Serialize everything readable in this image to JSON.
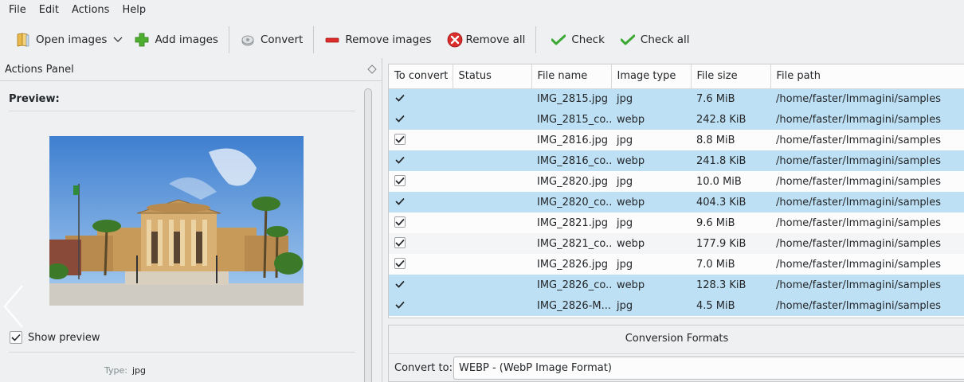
{
  "menubar": {
    "items": [
      "File",
      "Edit",
      "Actions",
      "Help"
    ]
  },
  "toolbar": {
    "open_images": "Open images",
    "add_images": "Add images",
    "convert": "Convert",
    "remove_images": "Remove images",
    "remove_all": "Remove all",
    "check": "Check",
    "check_all": "Check all"
  },
  "actions_panel": {
    "title": "Actions Panel",
    "preview_label": "Preview:",
    "show_preview_label": "Show preview",
    "show_preview_checked": true,
    "type_label": "Type:",
    "type_value": "jpg"
  },
  "table": {
    "columns": [
      "To convert",
      "Status",
      "File name",
      "Image type",
      "File size",
      "File path"
    ],
    "rows": [
      {
        "checked": true,
        "status": "",
        "name": "IMG_2815.jpg",
        "type": "jpg",
        "size": "7.6 MiB",
        "path": "/home/faster/Immagini/samples",
        "selected": true
      },
      {
        "checked": true,
        "status": "",
        "name": "IMG_2815_co...",
        "type": "webp",
        "size": "242.8 KiB",
        "path": "/home/faster/Immagini/samples",
        "selected": true
      },
      {
        "checked": true,
        "status": "",
        "name": "IMG_2816.jpg",
        "type": "jpg",
        "size": "8.8 MiB",
        "path": "/home/faster/Immagini/samples",
        "selected": false
      },
      {
        "checked": true,
        "status": "",
        "name": "IMG_2816_co...",
        "type": "webp",
        "size": "241.8 KiB",
        "path": "/home/faster/Immagini/samples",
        "selected": true
      },
      {
        "checked": true,
        "status": "",
        "name": "IMG_2820.jpg",
        "type": "jpg",
        "size": "10.0 MiB",
        "path": "/home/faster/Immagini/samples",
        "selected": false
      },
      {
        "checked": true,
        "status": "",
        "name": "IMG_2820_co...",
        "type": "webp",
        "size": "404.3 KiB",
        "path": "/home/faster/Immagini/samples",
        "selected": true
      },
      {
        "checked": true,
        "status": "",
        "name": "IMG_2821.jpg",
        "type": "jpg",
        "size": "9.6 MiB",
        "path": "/home/faster/Immagini/samples",
        "selected": false
      },
      {
        "checked": true,
        "status": "",
        "name": "IMG_2821_co...",
        "type": "webp",
        "size": "177.9 KiB",
        "path": "/home/faster/Immagini/samples",
        "selected": false
      },
      {
        "checked": true,
        "status": "",
        "name": "IMG_2826.jpg",
        "type": "jpg",
        "size": "7.0 MiB",
        "path": "/home/faster/Immagini/samples",
        "selected": false
      },
      {
        "checked": true,
        "status": "",
        "name": "IMG_2826_co...",
        "type": "webp",
        "size": "128.3 KiB",
        "path": "/home/faster/Immagini/samples",
        "selected": true
      },
      {
        "checked": true,
        "status": "",
        "name": "IMG_2826-M...",
        "type": "jpg",
        "size": "4.5 MiB",
        "path": "/home/faster/Immagini/samples",
        "selected": true
      }
    ]
  },
  "conversion": {
    "title": "Conversion Formats",
    "convert_to_label": "Convert to:",
    "convert_to_value": "WEBP - (WebP Image Format)"
  },
  "colors": {
    "selection": "#bee0f4",
    "window_bg": "#eff0f1",
    "check_green": "#2ecc40"
  }
}
